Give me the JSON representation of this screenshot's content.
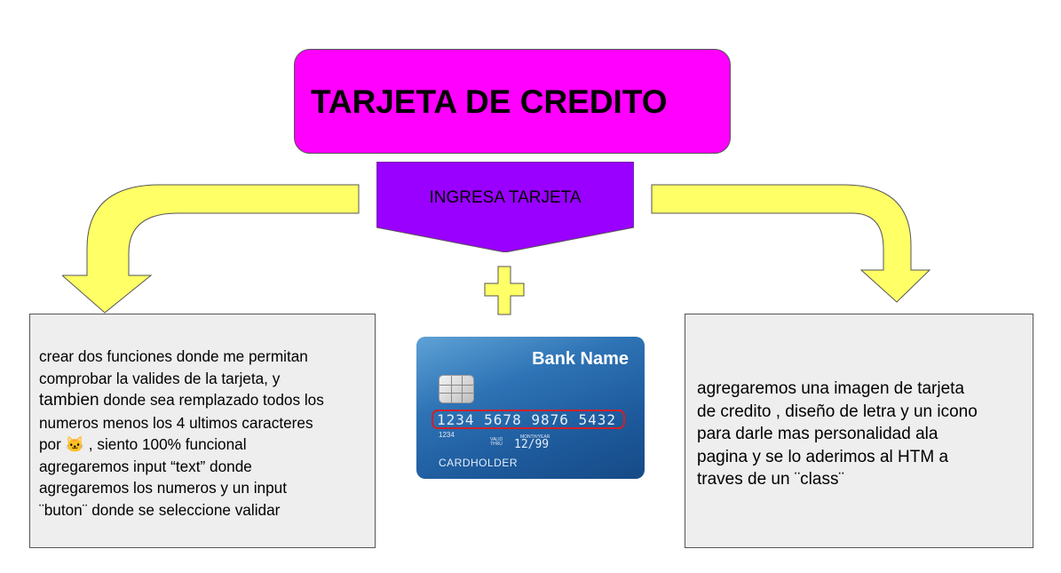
{
  "title": "TARJETA DE CREDITO",
  "center_label": "INGRESA TARJETA",
  "left_box": {
    "lines": [
      "crear dos funciones donde me permitan",
      "comprobar la valides de la tarjeta, y",
      "tambien",
      " donde sea remplazado todos los",
      "numeros menos los 4 ultimos caracteres",
      "por ",
      "🐱",
      " , siento 100% funcional",
      "agregaremos input “text” donde",
      "agregaremos los numeros y un input",
      "¨buton¨ donde se seleccione validar"
    ]
  },
  "right_box": {
    "lines": [
      "agregaremos una imagen de tarjeta",
      "de credito , diseño de letra y un icono",
      "para darle mas personalidad ala",
      "pagina y se lo aderimos al HTM a",
      "traves de un ¨class¨"
    ]
  },
  "card": {
    "bank_name": "Bank Name",
    "number": "1234 5678 9876 5432",
    "small_number": "1234",
    "valid_thru": "VALID THRU",
    "month_year": "MONTH/YEAR",
    "expiry": "12/99",
    "holder": "CARDHOLDER"
  },
  "colors": {
    "title_fill": "#ff00ff",
    "pentagon_fill": "#9900ff",
    "arrow_fill": "#ffff66",
    "box_fill": "#eeeeee"
  }
}
